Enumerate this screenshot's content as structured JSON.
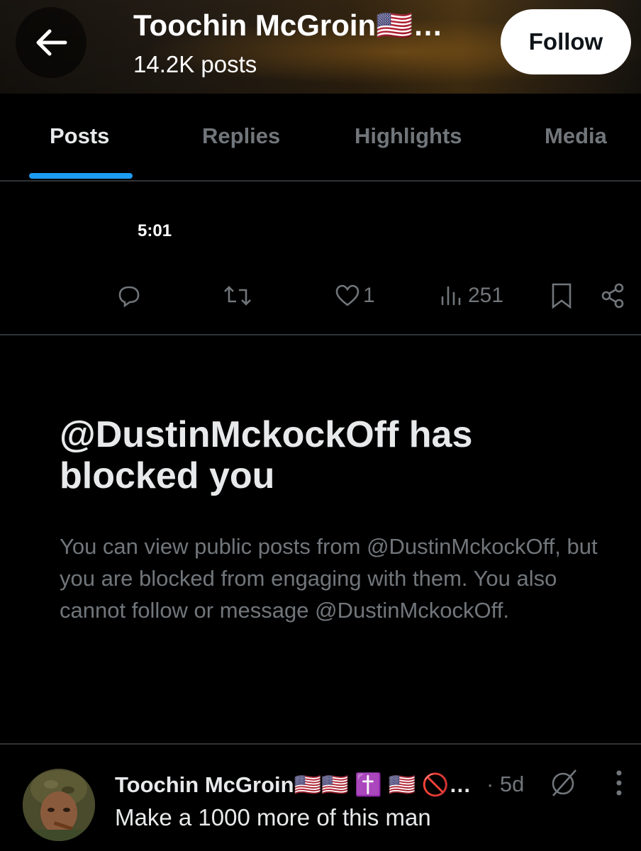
{
  "header": {
    "title": "Toochin McGroin🇺🇸…",
    "post_count": "14.2K posts",
    "follow_label": "Follow"
  },
  "tabs": [
    {
      "label": "Posts",
      "active": true
    },
    {
      "label": "Replies",
      "active": false
    },
    {
      "label": "Highlights",
      "active": false
    },
    {
      "label": "Media",
      "active": false
    }
  ],
  "video_post": {
    "duration": "5:01",
    "likes": "1",
    "views": "251"
  },
  "blocked": {
    "title": "@DustinMckockOff has blocked you",
    "body": "You can view public posts from @DustinMckockOff, but you are blocked from engaging with them. You also cannot follow or message @DustinMckockOff."
  },
  "bottom_post": {
    "author": "Toochin McGroin🇺🇸🇺🇸 ✝️ 🇺🇸 🚫…",
    "time": "· 5d",
    "text": "Make a 1000 more of this man"
  },
  "colors": {
    "accent": "#1d9bf0",
    "background": "#000000",
    "muted": "#71767b"
  }
}
